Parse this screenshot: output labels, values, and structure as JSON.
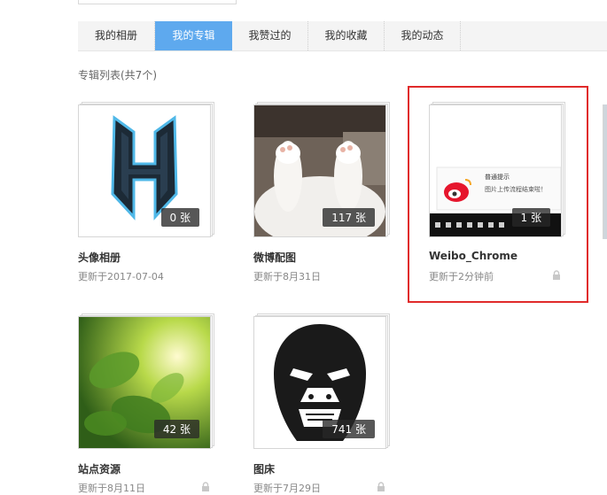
{
  "tabs": [
    {
      "label": "我的相册",
      "active": false
    },
    {
      "label": "我的专辑",
      "active": true
    },
    {
      "label": "我赞过的",
      "active": false
    },
    {
      "label": "我的收藏",
      "active": false
    },
    {
      "label": "我的动态",
      "active": false
    }
  ],
  "list_label": "专辑列表(共7个)",
  "albums": [
    {
      "name": "头像相册",
      "updated": "更新于2017-07-04",
      "count": "0 张",
      "locked": false,
      "icon": "h-logo"
    },
    {
      "name": "微博配图",
      "updated": "更新于8月31日",
      "count": "117 张",
      "locked": false,
      "icon": "cat-paws"
    },
    {
      "name": "Weibo_Chrome",
      "updated": "更新于2分钟前",
      "count": "1 张",
      "locked": true,
      "icon": "weibo-screenshot",
      "preview": {
        "title": "普通提示",
        "text": "图片上传流程结束啦！"
      }
    },
    {
      "name": "站点资源",
      "updated": "更新于8月11日",
      "count": "42 张",
      "locked": true,
      "icon": "green-leaves"
    },
    {
      "name": "图床",
      "updated": "更新于7月29日",
      "count": "741 张",
      "locked": true,
      "icon": "gorilla"
    }
  ],
  "colors": {
    "active_tab": "#5ea9ee",
    "highlight": "#e02a2a"
  }
}
